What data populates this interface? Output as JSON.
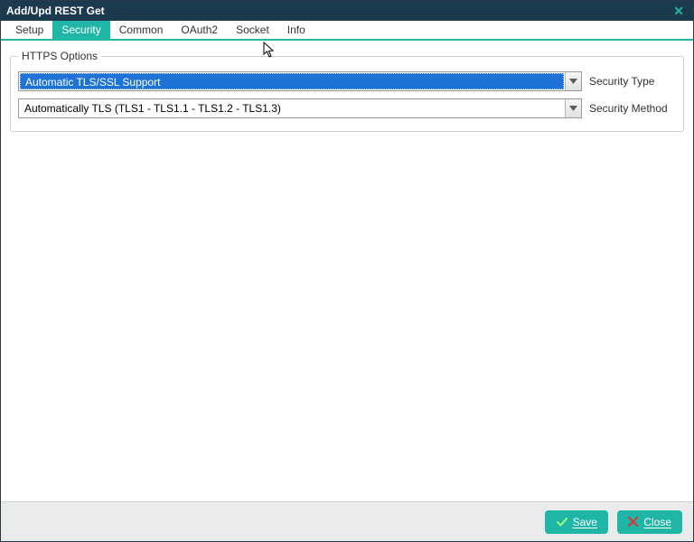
{
  "window": {
    "title": "Add/Upd REST Get"
  },
  "tabs": [
    {
      "label": "Setup",
      "active": false
    },
    {
      "label": "Security",
      "active": true
    },
    {
      "label": "Common",
      "active": false
    },
    {
      "label": "OAuth2",
      "active": false
    },
    {
      "label": "Socket",
      "active": false
    },
    {
      "label": "Info",
      "active": false
    }
  ],
  "group": {
    "legend": "HTTPS Options",
    "securityType": {
      "label": "Security Type",
      "value": "Automatic TLS/SSL Support"
    },
    "securityMethod": {
      "label": "Security Method",
      "value": "Automatically TLS (TLS1 - TLS1.1 - TLS1.2 - TLS1.3)"
    }
  },
  "footer": {
    "save": "Save",
    "close": "Close"
  }
}
